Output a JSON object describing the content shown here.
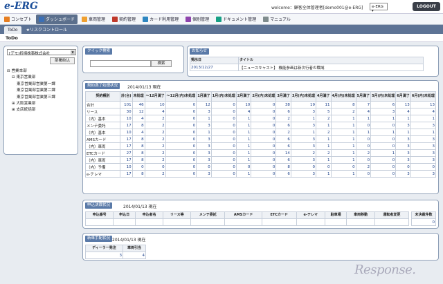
{
  "app": {
    "logo": "e-ERG",
    "welcome": "welcome：顧客全体管理者[demo001@e-ERG]",
    "selector": "e-ERG",
    "logout": "LOGOUT"
  },
  "nav": [
    {
      "label": "コンセプト",
      "icon": "concept-icon",
      "color": "#e67e22"
    },
    {
      "label": "ダッシュボード",
      "icon": "dashboard-icon",
      "color": "#3b6fb6",
      "active": true
    },
    {
      "label": "車両管理",
      "icon": "car-icon",
      "color": "#f0a030"
    },
    {
      "label": "契約管理",
      "icon": "contract-icon",
      "color": "#c0392b"
    },
    {
      "label": "カード利用管理",
      "icon": "card-icon",
      "color": "#2e86c1"
    },
    {
      "label": "個別管理",
      "icon": "person-icon",
      "color": "#8e44ad"
    },
    {
      "label": "ドキュメント管理",
      "icon": "document-icon",
      "color": "#16a085"
    },
    {
      "label": "マニュアル",
      "icon": "manual-icon",
      "color": "#7f8c8d"
    }
  ],
  "subtabs": [
    {
      "label": "ToDo",
      "active": true
    },
    {
      "label": "★リスクコントロール"
    }
  ],
  "crumb": "ToDo",
  "left": {
    "company": "[デモ]折柄株事株式会社",
    "narrow_btn": "部署絞込",
    "tree": [
      {
        "label": "⊟ 営業本部",
        "indent": 0
      },
      {
        "label": "⊟ 東京営業部",
        "indent": 1
      },
      {
        "label": "東京営業部営業第一課",
        "indent": 2
      },
      {
        "label": "東京営業部営業第二課",
        "indent": 2
      },
      {
        "label": "東京営業部営業第三課",
        "indent": 2
      },
      {
        "label": "⊞ 大阪営業部",
        "indent": 1
      },
      {
        "label": "⊞ 支店統括部",
        "indent": 1
      }
    ]
  },
  "quick": {
    "header": "クイック検索",
    "button": "検索"
  },
  "notice": {
    "header": "お知らせ",
    "cols": [
      "掲示日",
      "タイトル"
    ],
    "rows": [
      {
        "date": "2013/12/27",
        "title": "【ニュースキャスト】 機能参画は新次行者の職域"
      }
    ]
  },
  "contract": {
    "header": "契約満了処理状況",
    "date": "2014/01/13 現在",
    "cols": [
      "契約種別",
      "計(台)",
      "未処理",
      "～12月満了",
      "～12月(内)未処理",
      "1月満了",
      "1月(内)未処理",
      "2月満了",
      "2月(内)未処理",
      "3月満了",
      "3月(内)未処理",
      "4月満了",
      "4月(内)未処理",
      "5月満了",
      "5月(内)未処理",
      "6月満了",
      "6月(内)未処理"
    ],
    "rows": [
      [
        "合計",
        "101",
        "46",
        "10",
        "0",
        "12",
        "0",
        "10",
        "0",
        "38",
        "19",
        "11",
        "8",
        "7",
        "6",
        "13",
        "13"
      ],
      [
        "リース",
        "30",
        "12",
        "4",
        "0",
        "3",
        "0",
        "4",
        "0",
        "6",
        "3",
        "5",
        "2",
        "4",
        "3",
        "4",
        "4"
      ],
      [
        "（内）基本",
        "10",
        "4",
        "2",
        "0",
        "1",
        "0",
        "1",
        "0",
        "2",
        "1",
        "2",
        "1",
        "1",
        "1",
        "1",
        "1"
      ],
      [
        "メンテ委託",
        "17",
        "8",
        "2",
        "0",
        "3",
        "0",
        "1",
        "0",
        "6",
        "3",
        "1",
        "1",
        "0",
        "0",
        "3",
        "3"
      ],
      [
        "（内）基本",
        "10",
        "4",
        "2",
        "0",
        "1",
        "0",
        "1",
        "0",
        "2",
        "1",
        "2",
        "1",
        "1",
        "1",
        "1",
        "1"
      ],
      [
        "AMSカード",
        "17",
        "8",
        "2",
        "0",
        "3",
        "0",
        "1",
        "0",
        "6",
        "3",
        "1",
        "1",
        "0",
        "0",
        "3",
        "3"
      ],
      [
        "（内）車両",
        "17",
        "8",
        "2",
        "0",
        "3",
        "0",
        "1",
        "0",
        "6",
        "3",
        "1",
        "1",
        "0",
        "0",
        "3",
        "3"
      ],
      [
        "ETCカード",
        "27",
        "8",
        "2",
        "0",
        "3",
        "0",
        "1",
        "0",
        "14",
        "2",
        "2",
        "1",
        "2",
        "1",
        "3",
        "3"
      ],
      [
        "（内）車両",
        "17",
        "8",
        "2",
        "0",
        "3",
        "0",
        "1",
        "0",
        "6",
        "3",
        "1",
        "1",
        "0",
        "0",
        "3",
        "3"
      ],
      [
        "（内）予備",
        "10",
        "0",
        "0",
        "0",
        "0",
        "0",
        "0",
        "0",
        "8",
        "0",
        "0",
        "0",
        "2",
        "0",
        "0",
        "0"
      ],
      [
        "e-テレマ",
        "17",
        "8",
        "2",
        "0",
        "3",
        "0",
        "1",
        "0",
        "6",
        "3",
        "1",
        "1",
        "0",
        "0",
        "3",
        "3"
      ]
    ]
  },
  "application": {
    "header": "申込決裁状況",
    "date": "2014/01/13 現在",
    "cols": [
      "申込番号",
      "申込日",
      "申込者名",
      "リース等",
      "メンテ委託",
      "AMSカード",
      "ETCカード",
      "e-テレマ",
      "駐車場",
      "車両移動",
      "運転者変更"
    ],
    "side_col": "未決裁件数",
    "side_value": "0"
  },
  "newprocure": {
    "header": "新車手配状況",
    "date": "2014/01/13 現在",
    "cols": [
      "ディーラー発注",
      "車両引当"
    ],
    "values": [
      "3",
      "4"
    ]
  },
  "watermark": "Response."
}
